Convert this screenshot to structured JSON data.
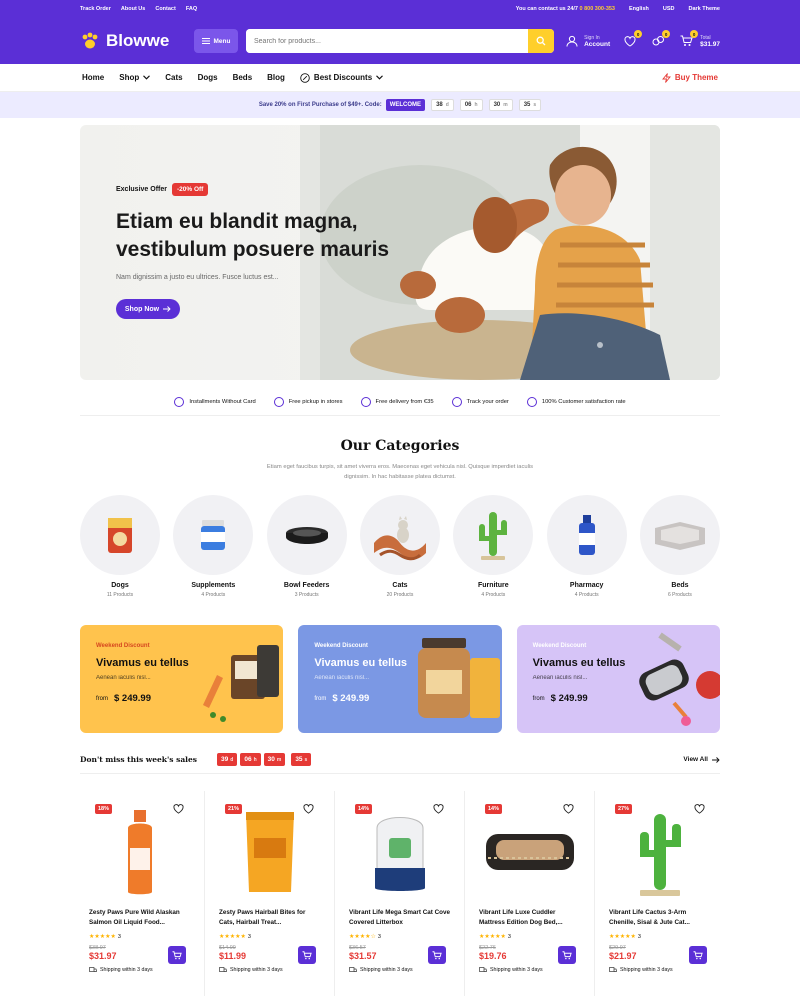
{
  "topbar": {
    "links": [
      "Track Order",
      "About Us",
      "Contact",
      "FAQ"
    ],
    "contact_text": "You can contact us 24/7",
    "phone": "0 800 300-353",
    "language": "English",
    "currency": "USD",
    "theme": "Dark Theme"
  },
  "header": {
    "brand": "Blowwe",
    "menu_label": "Menu",
    "search_placeholder": "Search for products...",
    "sign_in": "Sign In",
    "account": "Account",
    "wishlist_count": "0",
    "compare_count": "0",
    "cart_count": "0",
    "cart_total_label": "Total",
    "cart_total": "$31.97"
  },
  "nav": {
    "items": [
      "Home",
      "Shop",
      "Cats",
      "Dogs",
      "Beds",
      "Blog",
      "Best Discounts"
    ],
    "buy_theme": "Buy Theme"
  },
  "promo": {
    "text": "Save 20% on First Purchase of $49+. Code:",
    "code": "WELCOME",
    "countdown": [
      {
        "v": "38",
        "u": "d"
      },
      {
        "v": "06",
        "u": "h"
      },
      {
        "v": "30",
        "u": "m"
      },
      {
        "v": "35",
        "u": "s"
      }
    ]
  },
  "hero": {
    "offer_label": "Exclusive Offer",
    "offer_pct": "-20% Off",
    "headline": "Etiam eu blandit magna, vestibulum posuere mauris",
    "sub": "Nam dignissim a justo eu ultrices. Fusce luctus est...",
    "cta": "Shop Now"
  },
  "features": [
    "Installments Without Card",
    "Free pickup in stores",
    "Free delivery from €35",
    "Track your order",
    "100% Customer satisfaction rate"
  ],
  "categories_section": {
    "title": "Our Categories",
    "desc": "Etiam eget faucibus turpis, sit amet viverra eros. Maecenas eget vehicula nisl. Quisque imperdiet iaculis dignissim. In hac habitasse platea dictumst."
  },
  "categories": [
    {
      "name": "Dogs",
      "count": "11 Products"
    },
    {
      "name": "Supplements",
      "count": "4 Products"
    },
    {
      "name": "Bowl Feeders",
      "count": "3 Products"
    },
    {
      "name": "Cats",
      "count": "20 Products"
    },
    {
      "name": "Furniture",
      "count": "4 Products"
    },
    {
      "name": "Pharmacy",
      "count": "4 Products"
    },
    {
      "name": "Beds",
      "count": "6 Products"
    }
  ],
  "banners": [
    {
      "tag": "Weekend Discount",
      "title": "Vivamus eu tellus",
      "sub": "Aenean iaculis nisl...",
      "from": "from",
      "price": "$ 249.99"
    },
    {
      "tag": "Weekend Discount",
      "title": "Vivamus eu tellus",
      "sub": "Aenean iaculis nisl...",
      "from": "from",
      "price": "$ 249.99"
    },
    {
      "tag": "Weekend Discount",
      "title": "Vivamus eu tellus",
      "sub": "Aenean iaculis nisl...",
      "from": "from",
      "price": "$ 249.99"
    }
  ],
  "sales": {
    "title": "Don't miss this week's sales",
    "countdown": [
      {
        "v": "39",
        "u": "d"
      },
      {
        "v": "06",
        "u": "h"
      },
      {
        "v": "30",
        "u": "m"
      },
      {
        "v": "35",
        "u": "s"
      }
    ],
    "view_all": "View All"
  },
  "products": [
    {
      "discount": "18%",
      "name": "Zesty Paws Pure Wild Alaskan Salmon Oil Liquid Food...",
      "reviews": "3",
      "old": "$38.97",
      "price": "$31.97",
      "ship": "Shipping within 3 days"
    },
    {
      "discount": "21%",
      "name": "Zesty Paws Hairball Bites for Cats, Hairball Treat...",
      "reviews": "3",
      "old": "$14.99",
      "price": "$11.99",
      "ship": "Shipping within 3 days"
    },
    {
      "discount": "14%",
      "name": "Vibrant Life Mega Smart Cat Cove Covered Litterbox",
      "reviews": "3",
      "old": "$36.57",
      "price": "$31.57",
      "ship": "Shipping within 3 days"
    },
    {
      "discount": "14%",
      "name": "Vibrant Life Luxe Cuddler Mattress Edition Dog Bed,...",
      "reviews": "3",
      "old": "$22.76",
      "price": "$19.76",
      "ship": "Shipping within 3 days"
    },
    {
      "discount": "27%",
      "name": "Vibrant Life Cactus 3-Arm Chenille, Sisal & Jute Cat...",
      "reviews": "3",
      "old": "$29.97",
      "price": "$21.97",
      "ship": "Shipping within 3 days"
    }
  ]
}
